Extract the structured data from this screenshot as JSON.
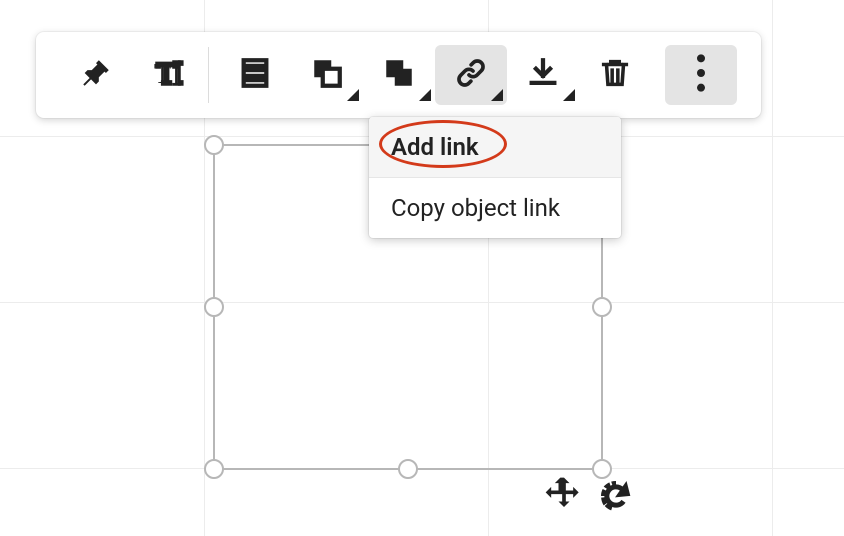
{
  "toolbar": {
    "buttons": [
      {
        "name": "pin-button",
        "icon": "pin-icon",
        "active": false,
        "dropdown": false
      },
      {
        "name": "text-style-button",
        "icon": "text-style-icon",
        "active": false,
        "dropdown": false
      },
      {
        "separator": true
      },
      {
        "name": "align-button",
        "icon": "align-icon",
        "active": false,
        "dropdown": false
      },
      {
        "name": "arrange-button",
        "icon": "arrange-icon",
        "active": false,
        "dropdown": true
      },
      {
        "name": "copy-style-button",
        "icon": "copy-style-icon",
        "active": false,
        "dropdown": true
      },
      {
        "name": "link-button",
        "icon": "link-icon",
        "active": true,
        "dropdown": true
      },
      {
        "name": "download-button",
        "icon": "download-icon",
        "active": false,
        "dropdown": true
      },
      {
        "name": "delete-button",
        "icon": "trash-icon",
        "active": false,
        "dropdown": false
      },
      {
        "name": "more-button",
        "icon": "more-icon",
        "active": true,
        "dropdown": false,
        "more": true
      }
    ]
  },
  "link_menu": {
    "items": [
      {
        "name": "menu-add-link",
        "label": "Add link",
        "highlighted": true
      },
      {
        "name": "menu-copy-object-link",
        "label": "Copy object link",
        "highlighted": false
      }
    ]
  },
  "selection": {
    "handles": [
      "tl",
      "tr",
      "bl",
      "br",
      "ml",
      "mr",
      "mt",
      "mb"
    ]
  }
}
